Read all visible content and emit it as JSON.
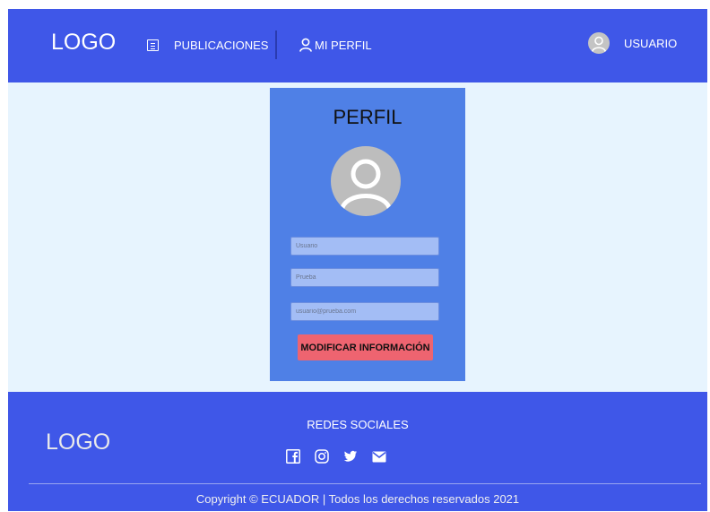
{
  "header": {
    "logo": "LOGO",
    "nav": [
      {
        "label": "PUBLICACIONES",
        "icon": "list-icon"
      },
      {
        "label": "MI PERFIL",
        "icon": "user-icon"
      }
    ],
    "user": {
      "label": "USUARIO",
      "icon": "avatar-icon"
    }
  },
  "profile": {
    "title": "PERFIL",
    "fields": [
      {
        "placeholder": "Usuario",
        "value": ""
      },
      {
        "placeholder": "Prueba",
        "value": ""
      },
      {
        "placeholder": "usuario@prueba.com",
        "value": ""
      }
    ],
    "submit_label": "MODIFICAR INFORMACIÓN"
  },
  "footer": {
    "logo": "LOGO",
    "social_title": "REDES SOCIALES",
    "social_icons": [
      "facebook-icon",
      "instagram-icon",
      "twitter-icon",
      "mail-icon"
    ],
    "copyright": "Copyright © ECUADOR  |  Todos los derechos reservados 2021"
  },
  "colors": {
    "primary": "#3f57e8",
    "background": "#e7f4fe",
    "card": "#4f80e6",
    "input": "#a3bdf5",
    "button": "#ee6470"
  }
}
